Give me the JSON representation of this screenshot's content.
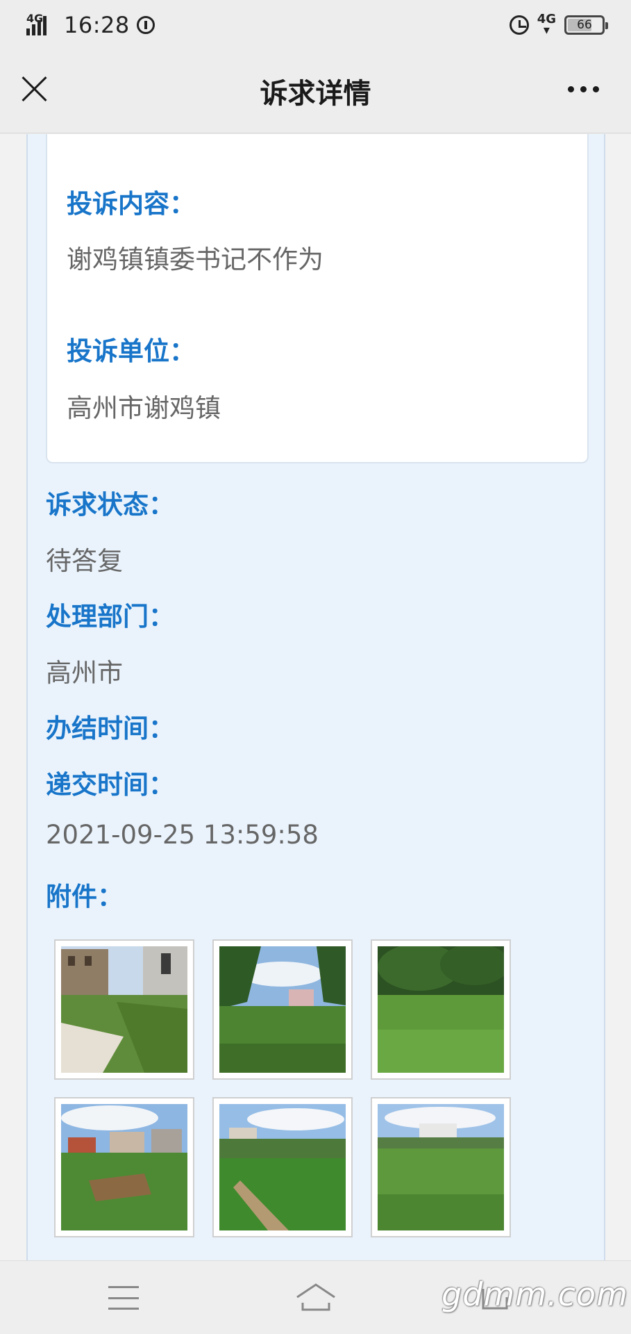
{
  "status_bar": {
    "network": "4G",
    "time": "16:28",
    "network_right": "4G",
    "battery": "66"
  },
  "nav": {
    "title": "诉求详情"
  },
  "card": {
    "complaint_content_label": "投诉内容：",
    "complaint_content": "谢鸡镇镇委书记不作为",
    "complaint_unit_label": "投诉单位：",
    "complaint_unit": "高州市谢鸡镇"
  },
  "details": {
    "status_label": "诉求状态：",
    "status": "待答复",
    "department_label": "处理部门：",
    "department": "高州市",
    "completed_label": "办结时间：",
    "submitted_label": "递交时间：",
    "submitted": "2021-09-25 13:59:58",
    "attachments_label": "附件："
  },
  "watermark": "gdmm.com"
}
